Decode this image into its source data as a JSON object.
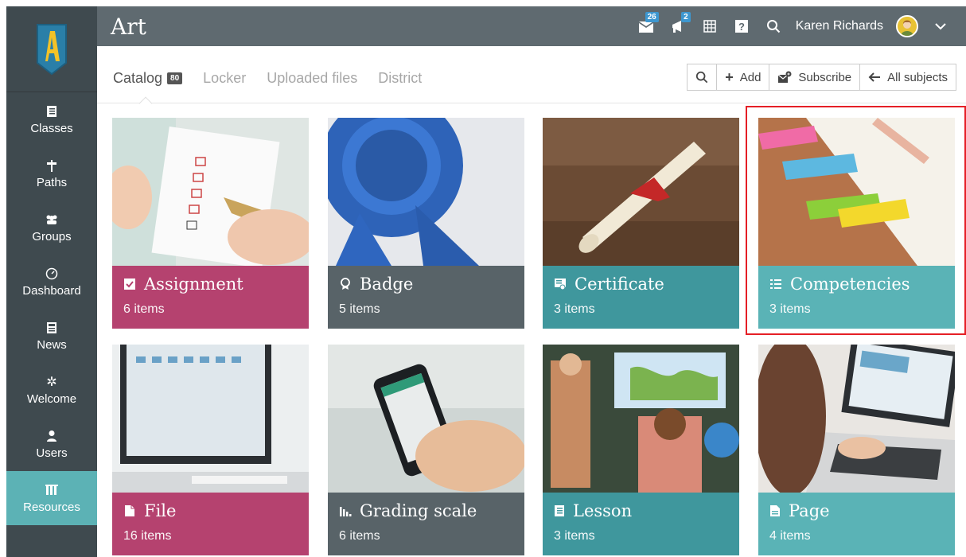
{
  "page_title": "Art",
  "topbar": {
    "messages_count": "26",
    "notifications_count": "2",
    "user_name": "Karen Richards"
  },
  "sidebar": {
    "items": [
      {
        "label": "Classes",
        "icon": "book-icon"
      },
      {
        "label": "Paths",
        "icon": "signpost-icon"
      },
      {
        "label": "Groups",
        "icon": "group-icon"
      },
      {
        "label": "Dashboard",
        "icon": "gauge-icon"
      },
      {
        "label": "News",
        "icon": "newspaper-icon"
      },
      {
        "label": "Welcome",
        "icon": "sparkle-icon"
      },
      {
        "label": "Users",
        "icon": "user-icon"
      },
      {
        "label": "Resources",
        "icon": "bookshelf-icon",
        "active": true
      }
    ]
  },
  "tabs": [
    {
      "label": "Catalog",
      "count": "80",
      "active": true
    },
    {
      "label": "Locker"
    },
    {
      "label": "Uploaded files"
    },
    {
      "label": "District"
    }
  ],
  "toolbar": {
    "add_label": "Add",
    "subscribe_label": "Subscribe",
    "all_subjects_label": "All subjects"
  },
  "cards": [
    {
      "title": "Assignment",
      "count": "6 items",
      "icon": "checkbox-icon",
      "color": "#b5426f"
    },
    {
      "title": "Badge",
      "count": "5 items",
      "icon": "ribbon-icon",
      "color": "#586368"
    },
    {
      "title": "Certificate",
      "count": "3 items",
      "icon": "certificate-icon",
      "color": "#3f979d"
    },
    {
      "title": "Competencies",
      "count": "3 items",
      "icon": "list-icon",
      "color": "#5ab3b6",
      "highlighted": true
    },
    {
      "title": "File",
      "count": "16 items",
      "icon": "file-icon",
      "color": "#b5426f"
    },
    {
      "title": "Grading scale",
      "count": "6 items",
      "icon": "bar-chart-icon",
      "color": "#586368"
    },
    {
      "title": "Lesson",
      "count": "3 items",
      "icon": "notebook-icon",
      "color": "#3f979d"
    },
    {
      "title": "Page",
      "count": "4 items",
      "icon": "page-icon",
      "color": "#5ab3b6"
    }
  ],
  "colors": {
    "sidebar": "#3f4a4f",
    "topbar": "#5f6a70",
    "accent_teal": "#5cb2b5",
    "magenta": "#b5426f",
    "highlight_border": "#e51f26"
  }
}
